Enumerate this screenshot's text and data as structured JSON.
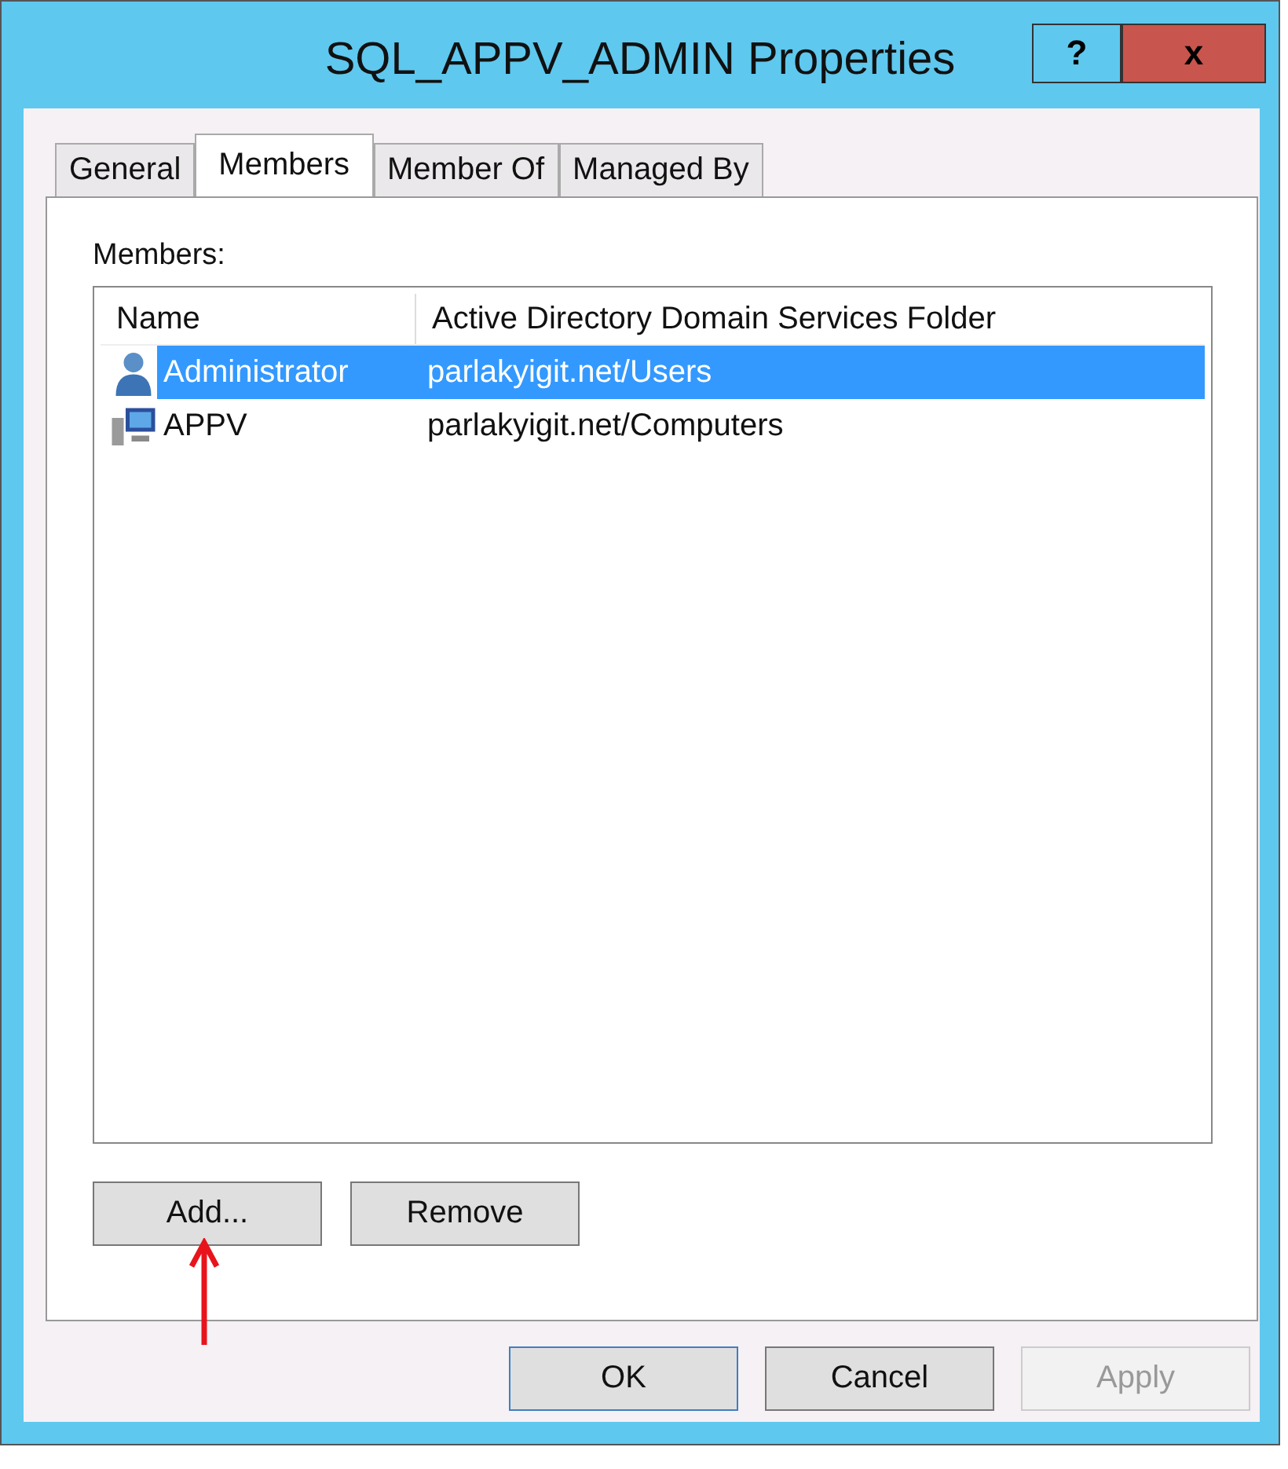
{
  "window": {
    "title": "SQL_APPV_ADMIN Properties",
    "help_button": "?",
    "close_button": "x"
  },
  "tabs": [
    {
      "label": "General",
      "selected": false
    },
    {
      "label": "Members",
      "selected": true
    },
    {
      "label": "Member Of",
      "selected": false
    },
    {
      "label": "Managed By",
      "selected": false
    }
  ],
  "members": {
    "label": "Members:",
    "columns": [
      "Name",
      "Active Directory Domain Services Folder"
    ],
    "rows": [
      {
        "kind": "user",
        "name": "Administrator",
        "folder": "parlakyigit.net/Users",
        "selected": true
      },
      {
        "kind": "computer",
        "name": "APPV",
        "folder": "parlakyigit.net/Computers",
        "selected": false
      }
    ]
  },
  "list_buttons": [
    "Add...",
    "Remove"
  ],
  "buttons": [
    {
      "label": "OK",
      "default": true,
      "disabled": false
    },
    {
      "label": "Cancel",
      "default": false,
      "disabled": false
    },
    {
      "label": "Apply",
      "default": false,
      "disabled": true
    }
  ]
}
